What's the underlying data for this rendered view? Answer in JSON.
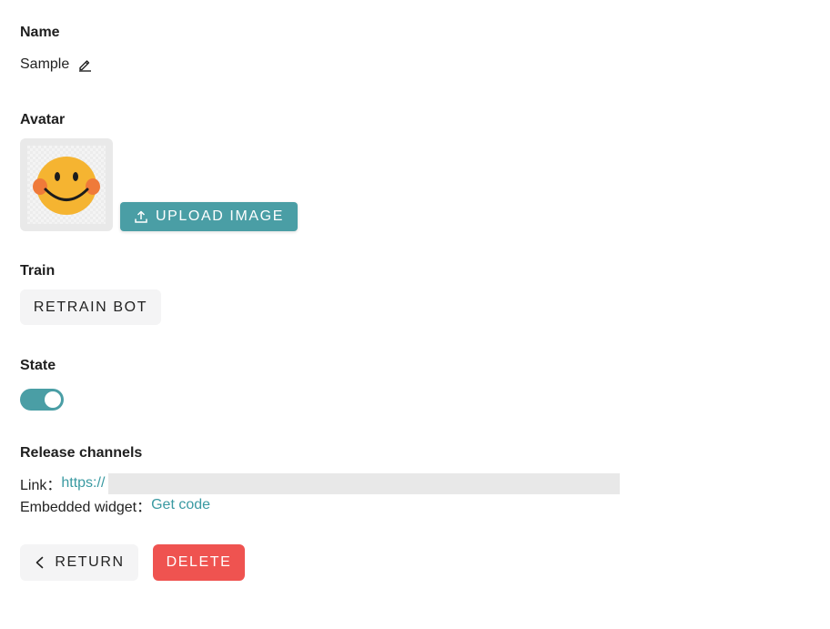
{
  "name_section": {
    "title": "Name",
    "value": "Sample",
    "edit_icon": "pencil-icon"
  },
  "avatar_section": {
    "title": "Avatar",
    "avatar_icon": "smiley-face",
    "upload_label": "UPLOAD IMAGE",
    "upload_icon": "upload-icon"
  },
  "train_section": {
    "title": "Train",
    "retrain_label": "RETRAIN BOT"
  },
  "state_section": {
    "title": "State",
    "enabled": true
  },
  "release_section": {
    "title": "Release channels",
    "link_label": "Link：",
    "link_url": "https://",
    "widget_label": "Embedded widget：",
    "widget_link": "Get code"
  },
  "actions": {
    "return_label": "RETURN",
    "return_icon": "chevron-left-icon",
    "delete_label": "DELETE"
  },
  "colors": {
    "accent": "#4a9ea5",
    "link": "#3a9aa2",
    "danger": "#ef5350",
    "neutral_button": "#f4f4f5"
  }
}
